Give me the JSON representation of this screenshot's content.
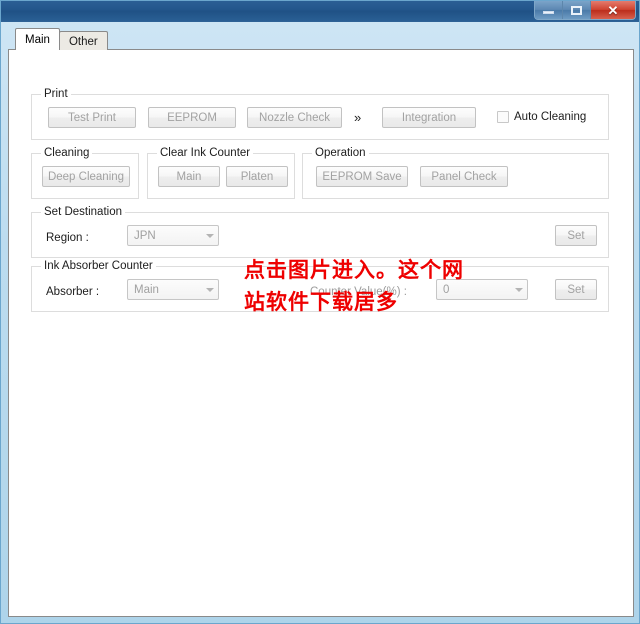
{
  "window": {
    "caption_buttons": [
      {
        "name": "minimize",
        "glyph": "minimize-icon"
      },
      {
        "name": "maximize",
        "glyph": "maximize-icon"
      },
      {
        "name": "close",
        "glyph": "close-icon",
        "label": "✕"
      }
    ]
  },
  "tabs": [
    {
      "label": "Main",
      "active": true
    },
    {
      "label": "Other",
      "active": false
    }
  ],
  "groups": {
    "print": {
      "legend": "Print",
      "buttons": [
        {
          "label": "Test Print"
        },
        {
          "label": "EEPROM"
        },
        {
          "label": "Nozzle Check"
        },
        {
          "label": "Integration"
        }
      ],
      "separator": "»",
      "checkbox": {
        "label": "Auto Cleaning",
        "checked": false
      }
    },
    "cleaning": {
      "legend": "Cleaning",
      "buttons": [
        {
          "label": "Deep Cleaning"
        }
      ]
    },
    "clear_ink_counter": {
      "legend": "Clear Ink Counter",
      "buttons": [
        {
          "label": "Main"
        },
        {
          "label": "Platen"
        }
      ]
    },
    "operation": {
      "legend": "Operation",
      "buttons": [
        {
          "label": "EEPROM Save"
        },
        {
          "label": "Panel Check"
        }
      ]
    },
    "set_destination": {
      "legend": "Set Destination",
      "region_label": "Region :",
      "region_value": "JPN",
      "set_label": "Set"
    },
    "ink_absorber_counter": {
      "legend": "Ink Absorber Counter",
      "absorber_label": "Absorber :",
      "absorber_value": "Main",
      "counter_label": "Counter Value(%) :",
      "counter_value": "0",
      "set_label": "Set"
    }
  },
  "watermark": {
    "line1": "点击图片进入。这个网",
    "line2": "站软件下载居多",
    "color": "#ee0000"
  }
}
